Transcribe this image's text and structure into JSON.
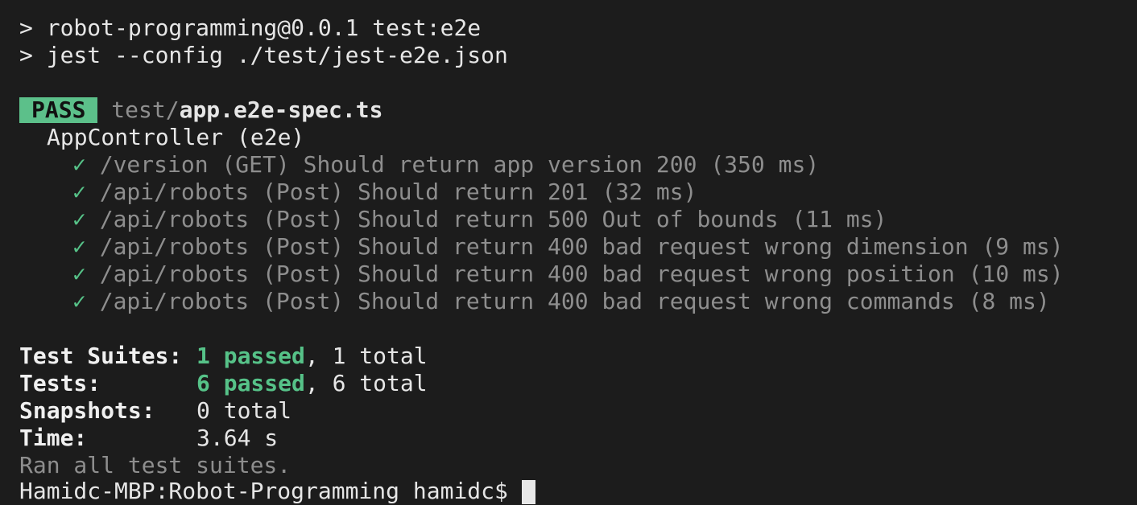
{
  "header": {
    "line1": "> robot-programming@0.0.1 test:e2e",
    "line2": "> jest --config ./test/jest-e2e.json"
  },
  "result": {
    "status": "PASS",
    "file_dir": "test/",
    "file_name": "app.e2e-spec.ts"
  },
  "suite": {
    "name": "AppController (e2e)",
    "check_glyph": "✓",
    "tests": [
      {
        "label": "/version (GET) Should return app version 200",
        "duration": "(350 ms)"
      },
      {
        "label": "/api/robots (Post) Should return 201",
        "duration": "(32 ms)"
      },
      {
        "label": "/api/robots (Post) Should return 500 Out of bounds",
        "duration": "(11 ms)"
      },
      {
        "label": "/api/robots (Post) Should return 400 bad request wrong dimension",
        "duration": "(9 ms)"
      },
      {
        "label": "/api/robots (Post) Should return 400 bad request wrong position",
        "duration": "(10 ms)"
      },
      {
        "label": "/api/robots (Post) Should return 400 bad request wrong commands",
        "duration": "(8 ms)"
      }
    ]
  },
  "summary": {
    "suites_label": "Test Suites:",
    "suites_passed": "1 passed",
    "suites_total": ", 1 total",
    "tests_label": "Tests:",
    "tests_passed": "6 passed",
    "tests_total": ", 6 total",
    "snapshots_label": "Snapshots:",
    "snapshots_value": "0 total",
    "time_label": "Time:",
    "time_value": "3.64 s",
    "ran_all": "Ran all test suites."
  },
  "prompt": {
    "text": "Hamidc-MBP:Robot-Programming hamidc$"
  },
  "colors": {
    "background": "#1c1c1c",
    "pass_badge": "#5cc08a",
    "passed_text": "#56c288",
    "dim_text": "#8e8e8e"
  }
}
